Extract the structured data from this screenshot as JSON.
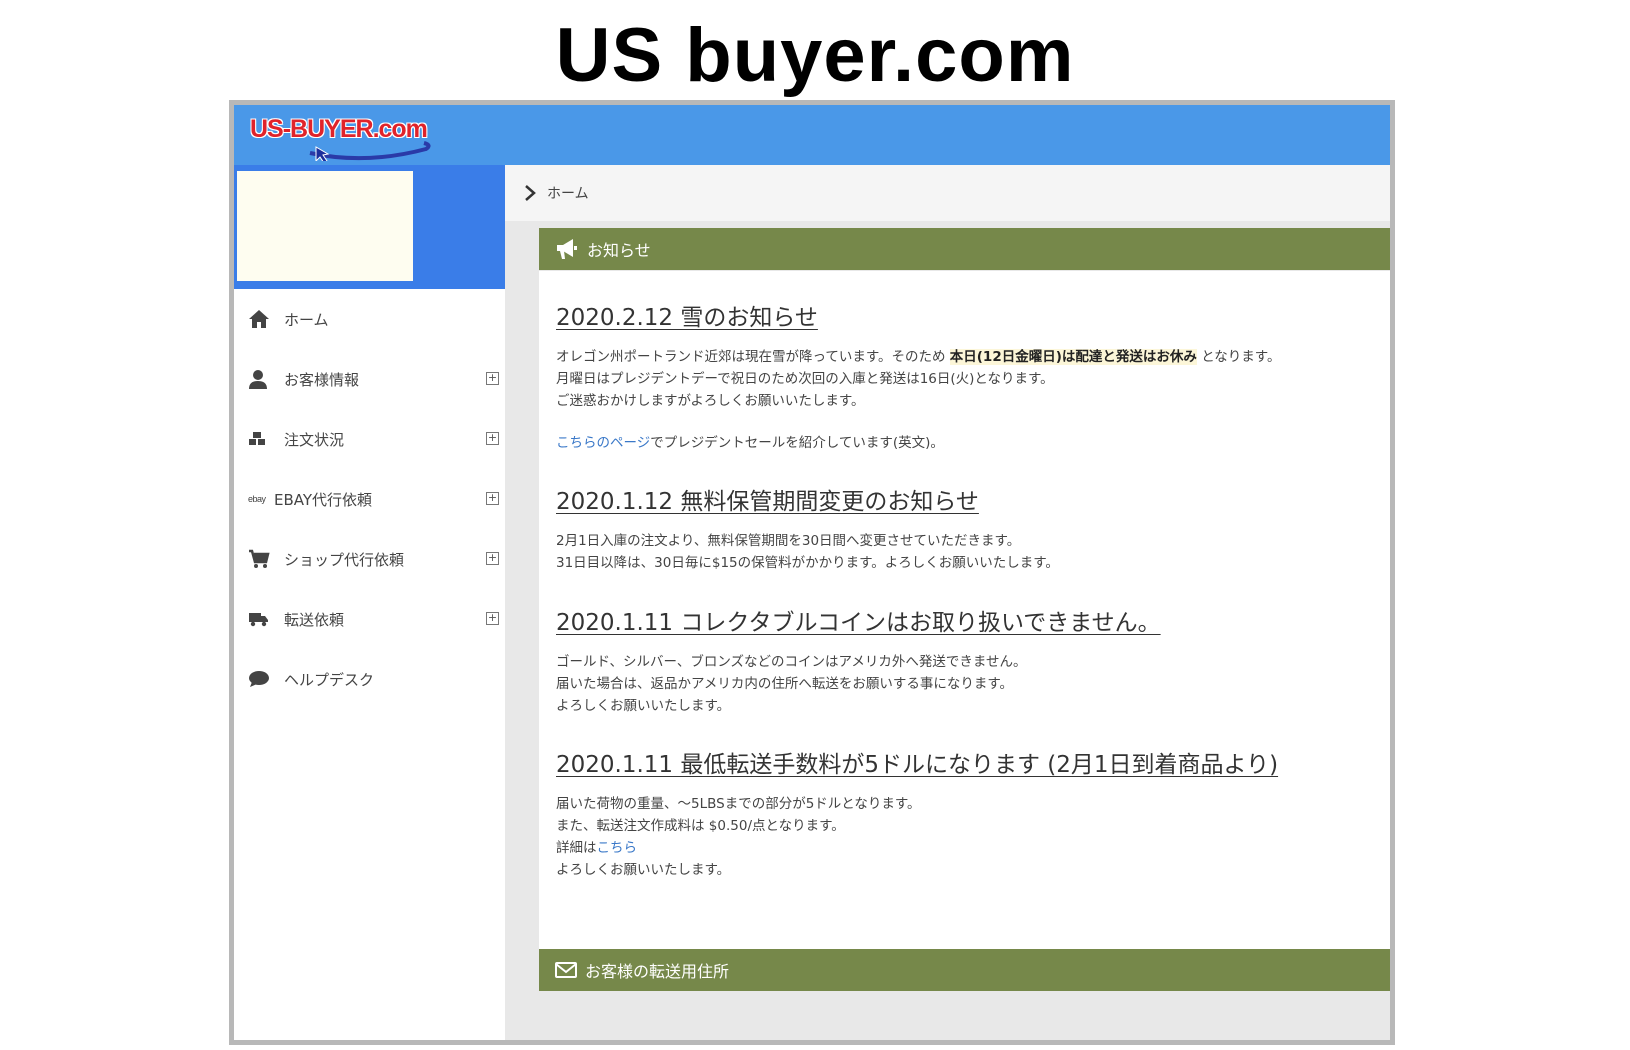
{
  "slide_title": "US buyer.com",
  "header": {
    "logo_text": "US-BUYER.com",
    "bg_color": "#4a98e8"
  },
  "sidebar": {
    "items": [
      {
        "label": "ホーム",
        "icon": "home-icon",
        "expandable": false
      },
      {
        "label": "お客様情報",
        "icon": "user-icon",
        "expandable": true
      },
      {
        "label": "注文状況",
        "icon": "cubes-icon",
        "expandable": true
      },
      {
        "label": "EBAY代行依頼",
        "icon": "ebay-icon",
        "icon_text": "ebay",
        "expandable": true
      },
      {
        "label": "ショップ代行依頼",
        "icon": "cart-icon",
        "expandable": true
      },
      {
        "label": "転送依頼",
        "icon": "truck-icon",
        "expandable": true
      },
      {
        "label": "ヘルプデスク",
        "icon": "comment-icon",
        "expandable": false
      }
    ],
    "expand_glyph": "+"
  },
  "breadcrumb": {
    "items": [
      "ホーム"
    ]
  },
  "notice_panel": {
    "title": "お知らせ",
    "icon": "bullhorn-icon",
    "header_color": "#76884a",
    "news": [
      {
        "title": "2020.2.12 雪のお知らせ",
        "line1_pre": "オレゴン州ポートランド近郊は現在雪が降っています。そのため ",
        "line1_highlight": "本日(12日金曜日)は配達と発送はお休み",
        "line1_post": " となります。",
        "line2": "月曜日はプレジデントデーで祝日のため次回の入庫と発送は16日(火)となります。",
        "line3": "ご迷惑おかけしますがよろしくお願いいたします。",
        "line5_link": "こちらのページ",
        "line5_post": "でプレジデントセールを紹介しています(英文)。"
      },
      {
        "title": "2020.1.12 無料保管期間変更のお知らせ",
        "line1": "2月1日入庫の注文より、無料保管期間を30日間へ変更させていただきます。",
        "line2": "31日目以降は、30日毎に$15の保管料がかかります。よろしくお願いいたします。"
      },
      {
        "title": "2020.1.11 コレクタブルコインはお取り扱いできません。",
        "line1": "ゴールド、シルバー、ブロンズなどのコインはアメリカ外へ発送できません。",
        "line2": "届いた場合は、返品かアメリカ内の住所へ転送をお願いする事になります。",
        "line3": "よろしくお願いいたします。"
      },
      {
        "title": "2020.1.11 最低転送手数料が5ドルになります (2月1日到着商品より)",
        "line1": "届いた荷物の重量、～5LBSまでの部分が5ドルとなります。",
        "line2": "また、転送注文作成料は $0.50/点となります。",
        "line3_pre": "詳細は",
        "line3_link": "こちら",
        "line4": "よろしくお願いいたします。"
      }
    ]
  },
  "address_panel": {
    "title": "お客様の転送用住所",
    "icon": "envelope-icon"
  }
}
